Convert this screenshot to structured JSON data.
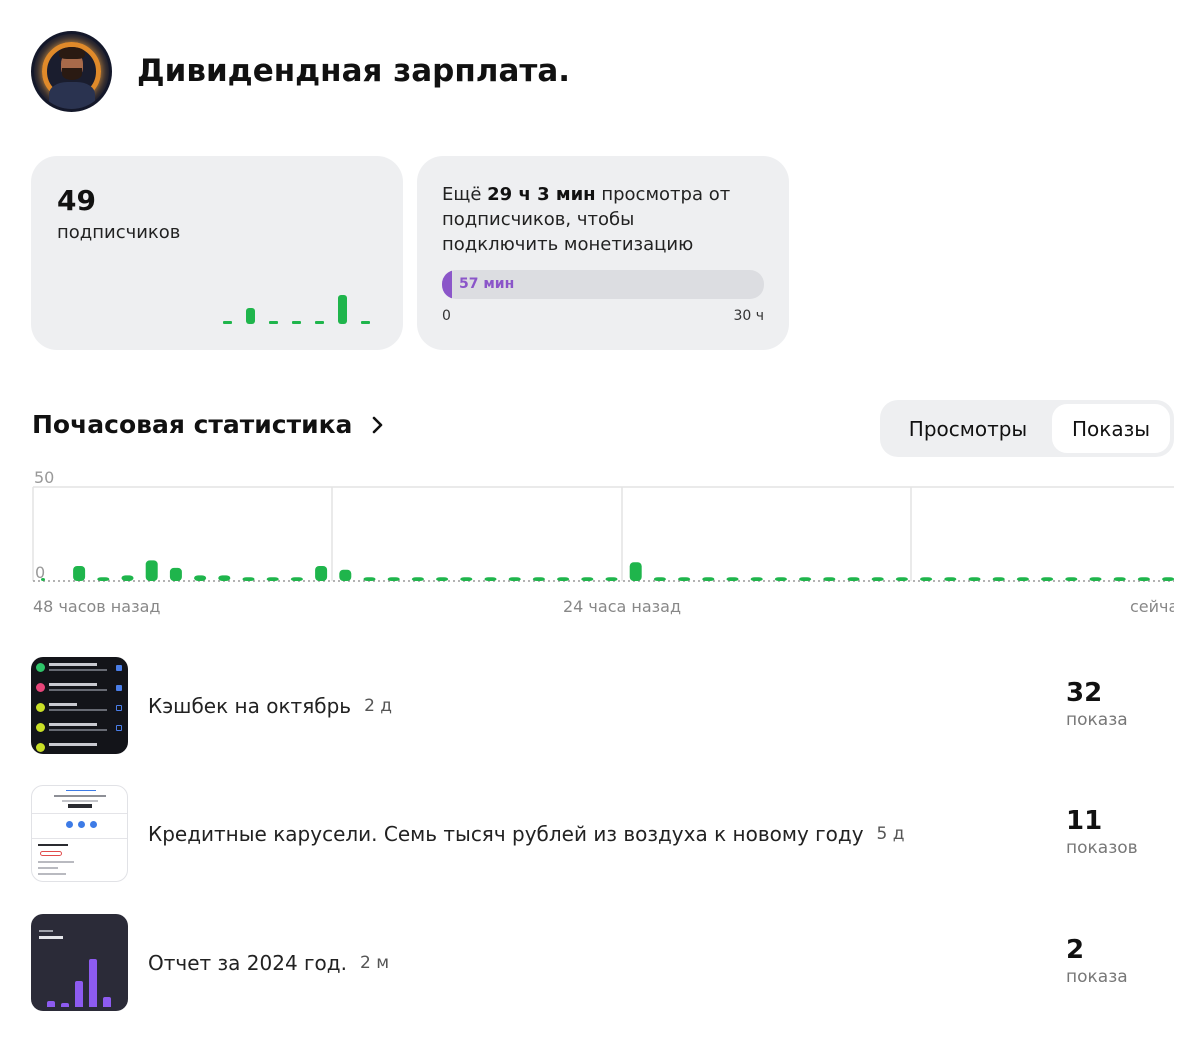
{
  "channel": {
    "title": "Дивидендная зарплата.",
    "avatar_icon": "channel-avatar"
  },
  "subscribers": {
    "count": "49",
    "label": "подписчиков",
    "mini_chart": [
      0,
      1,
      0,
      0,
      0,
      2,
      0
    ]
  },
  "monetization": {
    "text_prefix": "Ещё ",
    "text_bold": "29 ч 3 мин",
    "text_suffix": " просмотра от подписчиков, чтобы подключить монетизацию",
    "progress_label": "57 мин",
    "progress_fraction": 0.032,
    "min_label": "0",
    "max_label": "30 ч",
    "accent_color": "#8b56c9"
  },
  "hourly": {
    "title": "Почасовая статистика",
    "arrow_icon": "chevron-right-icon",
    "tabs": [
      {
        "label": "Просмотры",
        "selected": false
      },
      {
        "label": "Показы",
        "selected": true
      }
    ]
  },
  "chart_data": {
    "type": "bar",
    "title": "Почасовая статистика",
    "ylim": [
      0,
      50
    ],
    "y_ticks": [
      "50",
      "0"
    ],
    "x_ticks": [
      "48 часов назад",
      "24 часа назад",
      "сейчас"
    ],
    "bar_color": "#1fb54c",
    "future_bar_color": "#a9dcb6",
    "values": [
      1,
      8,
      2,
      3,
      11,
      7,
      3,
      3,
      2,
      2,
      2,
      8,
      6,
      2,
      2,
      2,
      2,
      2,
      2,
      2,
      2,
      2,
      2,
      2,
      10,
      2,
      2,
      2,
      2,
      2,
      2,
      2,
      2,
      2,
      2,
      2,
      2,
      2,
      2,
      2,
      2,
      2,
      2,
      2,
      2,
      2,
      2,
      2
    ],
    "future_values": [
      2,
      2,
      2,
      2,
      2,
      2
    ]
  },
  "posts": [
    {
      "title": "Кэшбек на октябрь",
      "age": "2 д",
      "count": "32",
      "unit": "показа",
      "thumb_icon": "cashback-list-thumbnail"
    },
    {
      "title": "Кредитные карусели. Семь тысяч рублей из воздуха к новому году",
      "age": "5 д",
      "count": "11",
      "unit": "показов",
      "thumb_icon": "bank-app-thumbnail"
    },
    {
      "title": "Отчет за 2024 год.",
      "age": "2 м",
      "count": "2",
      "unit": "показа",
      "thumb_icon": "bar-chart-thumbnail"
    }
  ]
}
